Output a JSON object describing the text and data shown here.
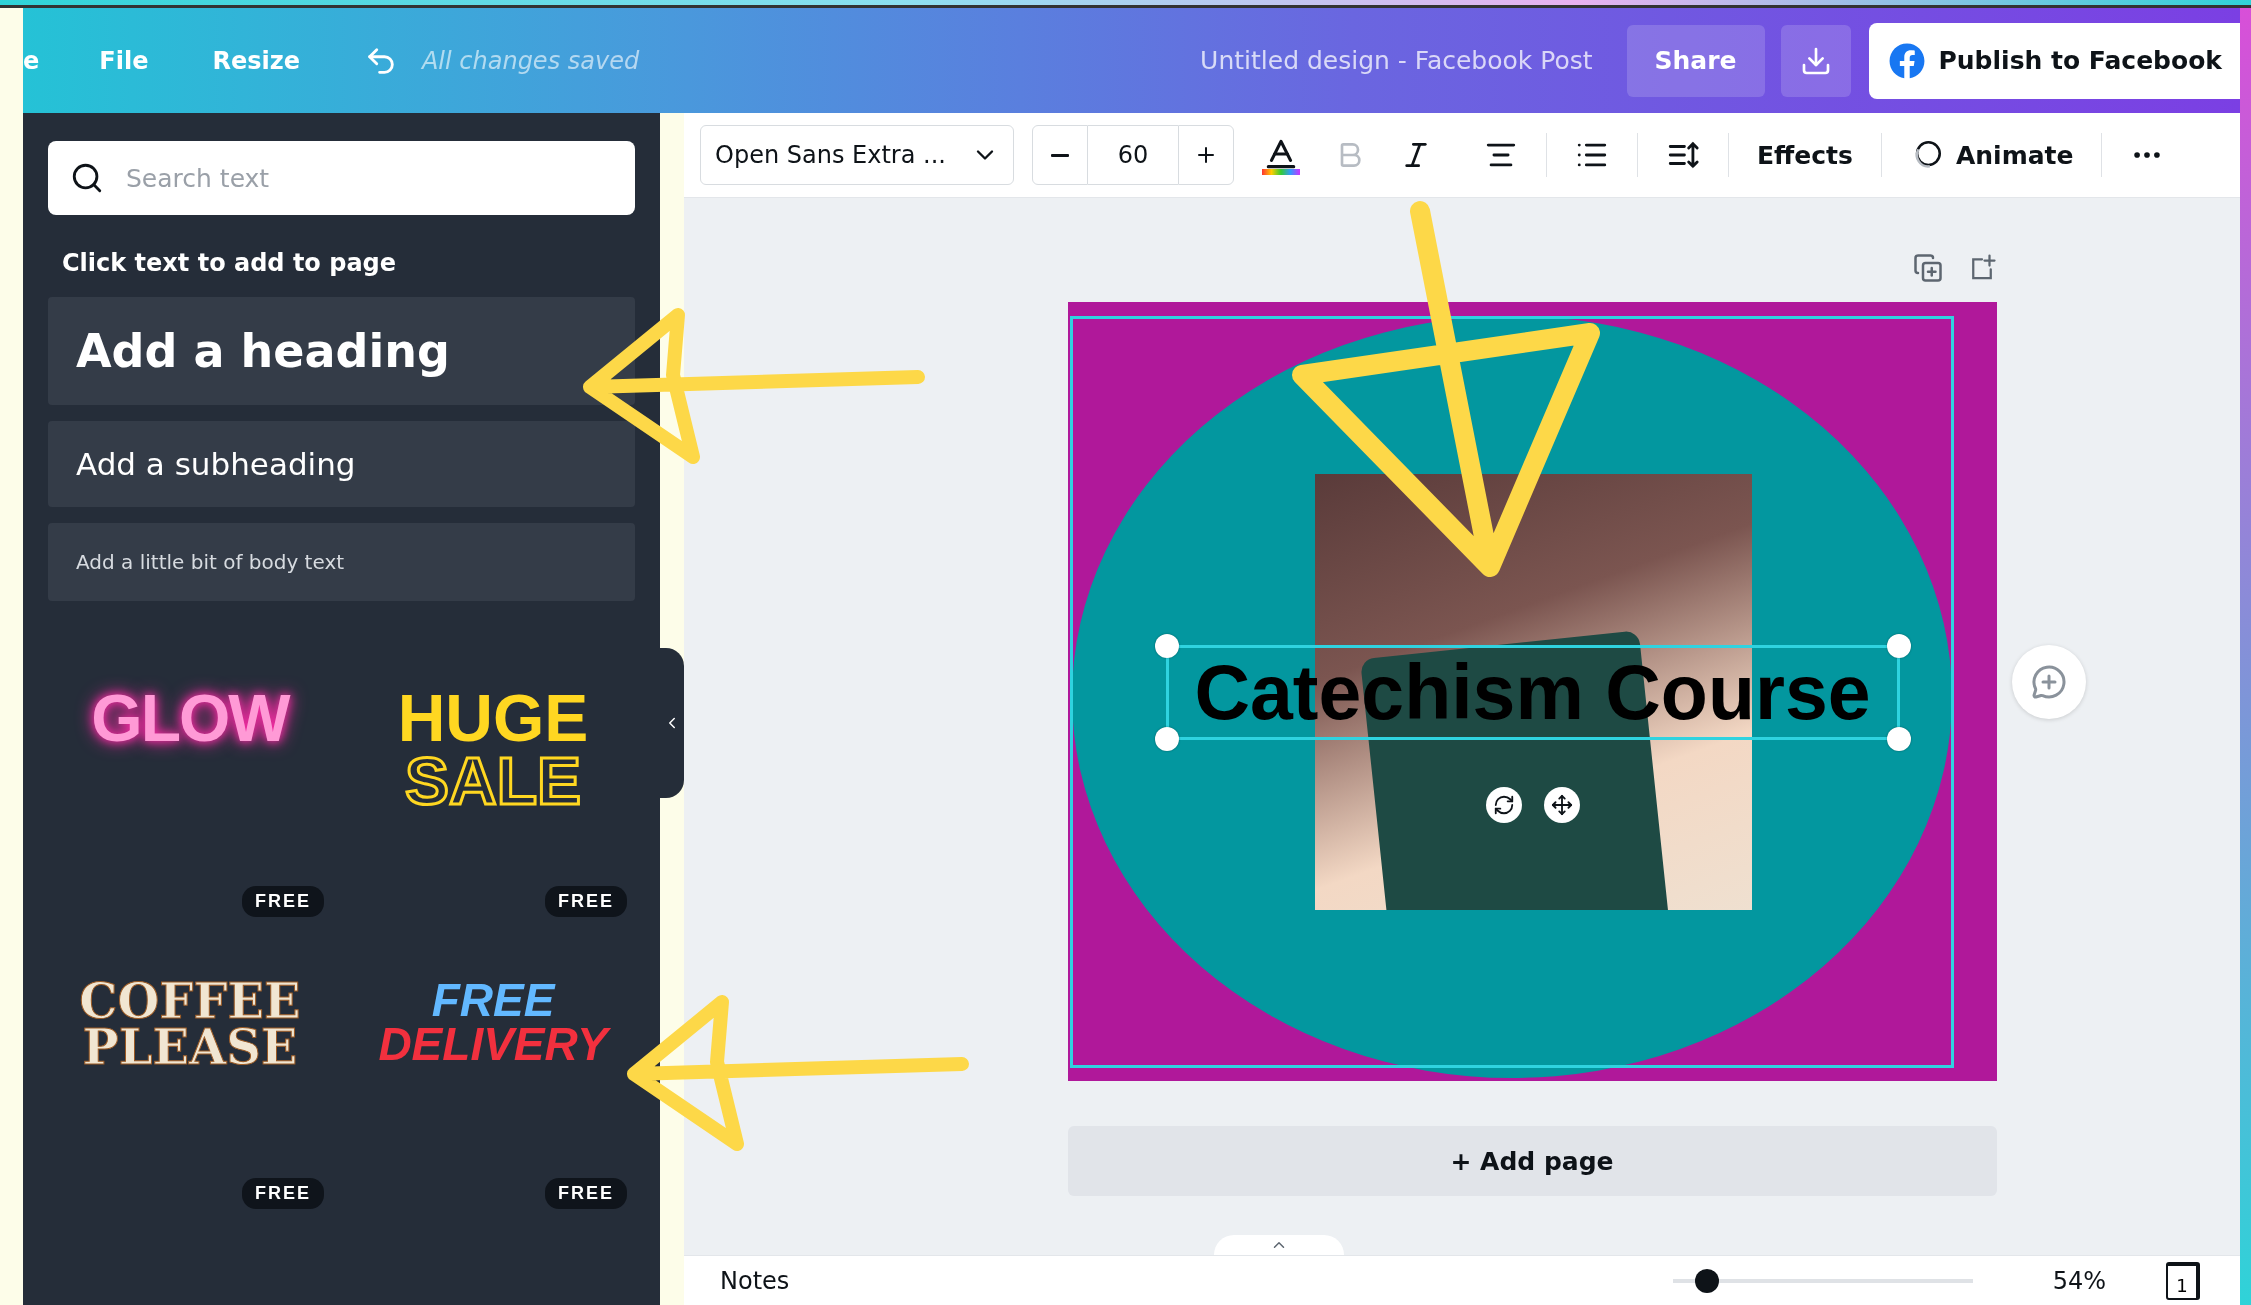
{
  "top_bar": {
    "menu": [
      {
        "label": "e"
      },
      {
        "label": "File"
      },
      {
        "label": "Resize"
      }
    ],
    "save_status": "All changes saved",
    "document_title": "Untitled design - Facebook Post",
    "share": "Share",
    "publish": "Publish to Facebook"
  },
  "text_panel": {
    "search": {
      "placeholder": "Search text"
    },
    "hint": "Click text to add to page",
    "text_styles": [
      {
        "kind": "heading",
        "label": "Add a heading"
      },
      {
        "kind": "subheading",
        "label": "Add a subheading"
      },
      {
        "kind": "body",
        "label": "Add a little bit of body text"
      }
    ],
    "templates": [
      {
        "kind": "glow",
        "lines": [
          "GLOW"
        ],
        "badge": "FREE"
      },
      {
        "kind": "huge_sale",
        "lines": [
          "HUGE",
          "SALE"
        ],
        "badge": "FREE"
      },
      {
        "kind": "coffee",
        "lines": [
          "COFFEE",
          "PLEASE"
        ],
        "badge": "FREE"
      },
      {
        "kind": "delivery",
        "lines": [
          "FREE",
          "DELIVERY"
        ],
        "badge": "FREE"
      }
    ]
  },
  "toolbar": {
    "font": "Open Sans Extra ...",
    "font_size": "60",
    "bold_disabled": true,
    "effects": "Effects",
    "animate": "Animate"
  },
  "canvas": {
    "text": "Catechism Course",
    "add_page": "+ Add page"
  },
  "bottom_bar": {
    "notes": "Notes",
    "zoom": {
      "level": 0.08
    },
    "zoom_reading": "54%",
    "page_count": "1"
  }
}
